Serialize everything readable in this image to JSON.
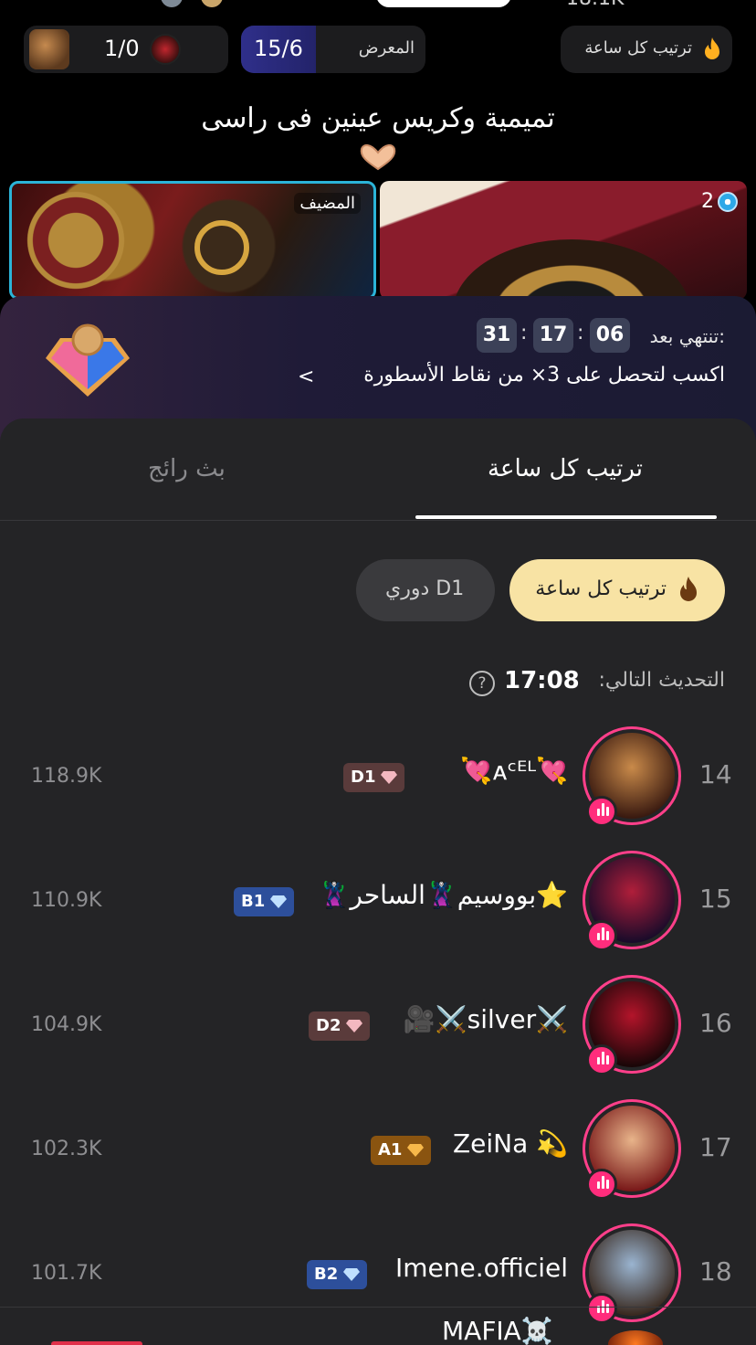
{
  "top": {
    "partial_count": "18.1K"
  },
  "stats": {
    "pk_score": "1/0",
    "exhibit_score": "15/6",
    "exhibit_label": "المعرض",
    "hourly_label": "ترتيب كل ساعة"
  },
  "room": {
    "title": "تميمية وكريس عينين فى راسى",
    "host_tag": "المضيف",
    "guest_count": "2"
  },
  "promo": {
    "ends_label": "تنتهي بعد:",
    "timer": [
      "06",
      "17",
      "31"
    ],
    "text": "اكسب لتحصل على 3× من نقاط الأسطورة",
    "arrow": "<"
  },
  "tabs": [
    {
      "label": "ترتيب كل ساعة",
      "active": true
    },
    {
      "label": "بث رائج",
      "active": false
    }
  ],
  "chips": [
    {
      "label": "ترتيب كل ساعة",
      "active": true
    },
    {
      "label": "دوري D1",
      "active": false
    }
  ],
  "next_update": {
    "label": "التحديث التالي:",
    "time": "17:08",
    "help": "?"
  },
  "rows": [
    {
      "rank": "14",
      "name": "💘ᴀᶜᴱᴸ💘",
      "tier": "D1",
      "tier_color": "#5a3b3b",
      "gem_color": "#f3b8c0",
      "score": "118.9K",
      "avatar_colors": [
        "#c98a4a",
        "#3a1a10"
      ]
    },
    {
      "rank": "15",
      "name": "⭐بووسيم🦹الساحر🦹",
      "tier": "B1",
      "tier_color": "#2d4f9b",
      "gem_color": "#bfe0ff",
      "score": "110.9K",
      "avatar_colors": [
        "#b01e3a",
        "#1a0b2a"
      ]
    },
    {
      "rank": "16",
      "name": "⚔️silver⚔️🎥",
      "tier": "D2",
      "tier_color": "#5a3b3b",
      "gem_color": "#f3b8c0",
      "score": "104.9K",
      "avatar_colors": [
        "#b3142a",
        "#1a0608"
      ]
    },
    {
      "rank": "17",
      "name": "💫 ZeiNa",
      "tier": "A1",
      "tier_color": "#8a5410",
      "gem_color": "#f7b84a",
      "score": "102.3K",
      "avatar_colors": [
        "#e8b48a",
        "#7a1a1a"
      ]
    },
    {
      "rank": "18",
      "name": "Imene.officiel",
      "tier": "B2",
      "tier_color": "#2d4f9b",
      "gem_color": "#bfe0ff",
      "score": "101.7K",
      "avatar_colors": [
        "#9ab4d0",
        "#3a2a20"
      ]
    }
  ],
  "partial_row": {
    "name": "MAFIA☠️"
  },
  "colors": {
    "accent_pink": "#ff3f8a",
    "chip_active": "#f8e3a4",
    "host_border": "#2bb4d8"
  }
}
